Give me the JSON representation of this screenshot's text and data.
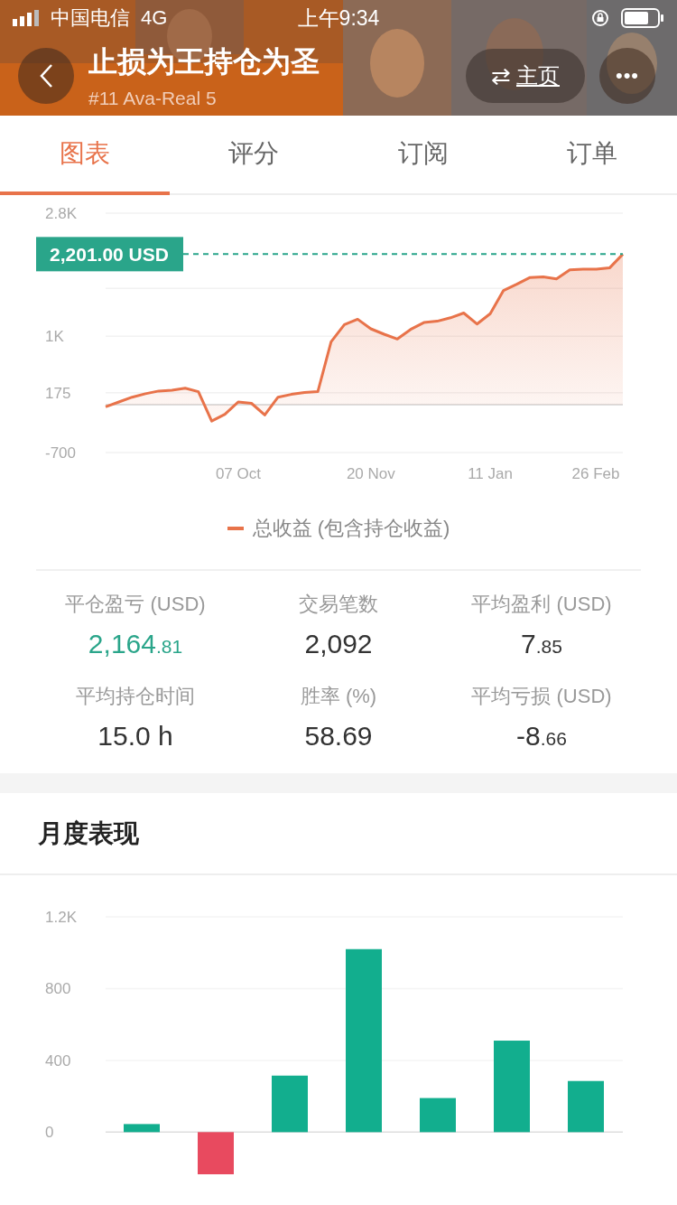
{
  "status_bar": {
    "carrier": "中国电信",
    "network": "4G",
    "time": "上午9:34"
  },
  "header": {
    "title": "止损为王持仓为圣",
    "subtitle": "#11 Ava-Real 5",
    "home_button": {
      "icon": "⇄",
      "label": "主页"
    },
    "more_button": "•••"
  },
  "tabs": [
    {
      "label": "图表",
      "selected": true
    },
    {
      "label": "评分",
      "selected": false
    },
    {
      "label": "订阅",
      "selected": false
    },
    {
      "label": "订单",
      "selected": false
    }
  ],
  "equity_chart": {
    "chart_data": {
      "type": "area",
      "ylim": [
        -700,
        2800
      ],
      "ref_lines": [
        {
          "axis": "y",
          "value": 2201,
          "label": "2,201.00 USD",
          "color": "#2aa58a"
        }
      ],
      "yticks": [
        {
          "value": 2800,
          "label": "2.8K"
        },
        {
          "value": 1000,
          "label": "1K"
        },
        {
          "value": 175,
          "label": "175"
        },
        {
          "value": -700,
          "label": "-700"
        }
      ],
      "categories": [
        null,
        null,
        null,
        null,
        null,
        null,
        null,
        null,
        null,
        null,
        "07 Oct",
        null,
        null,
        null,
        null,
        null,
        null,
        null,
        null,
        null,
        "20 Nov",
        null,
        null,
        null,
        null,
        null,
        null,
        null,
        null,
        "11 Jan",
        null,
        null,
        null,
        null,
        null,
        null,
        null,
        "26 Feb",
        null,
        null
      ],
      "series": [
        {
          "name": "总收益 (包含持仓收益)",
          "color": "#e8734a",
          "values": [
            -30,
            40,
            110,
            160,
            200,
            210,
            240,
            190,
            -240,
            -140,
            40,
            20,
            -150,
            110,
            150,
            180,
            190,
            920,
            1170,
            1250,
            1110,
            1030,
            960,
            1100,
            1200,
            1220,
            1270,
            1340,
            1180,
            1330,
            1670,
            1760,
            1860,
            1870,
            1840,
            1970,
            1980,
            1980,
            2000,
            2200
          ]
        }
      ]
    }
  },
  "stats": [
    {
      "label": "平仓盈亏 (USD)",
      "main": "2,164",
      "fraction": ".81",
      "color": "#2aa58a"
    },
    {
      "label": "交易笔数",
      "main": "2,092",
      "color": "#333333"
    },
    {
      "label": "平均盈利 (USD)",
      "main": "7",
      "fraction": ".85",
      "color": "#333333"
    },
    {
      "label": "平均持仓时间",
      "main": "15.0 h",
      "color": "#333333"
    },
    {
      "label": "胜率 (%)",
      "main": "58.69",
      "color": "#333333"
    },
    {
      "label": "平均亏损 (USD)",
      "main": "-8",
      "fraction": ".66",
      "color": "#333333"
    }
  ],
  "monthly": {
    "title": "月度表现",
    "chart_data": {
      "type": "bar",
      "ylim": [
        -235,
        1200
      ],
      "yticks": [
        {
          "value": 1200,
          "label": "1.2K"
        },
        {
          "value": 800,
          "label": "800"
        },
        {
          "value": 400,
          "label": "400"
        },
        {
          "value": 0,
          "label": "0"
        }
      ],
      "stacked": true,
      "series": [
        {
          "color": "#12ae8e",
          "values": [
            45,
            null,
            315,
            1020,
            190,
            510,
            285
          ]
        },
        {
          "color": "#e84a5f",
          "values": [
            null,
            -235,
            null,
            null,
            null,
            null,
            null
          ]
        }
      ]
    }
  }
}
